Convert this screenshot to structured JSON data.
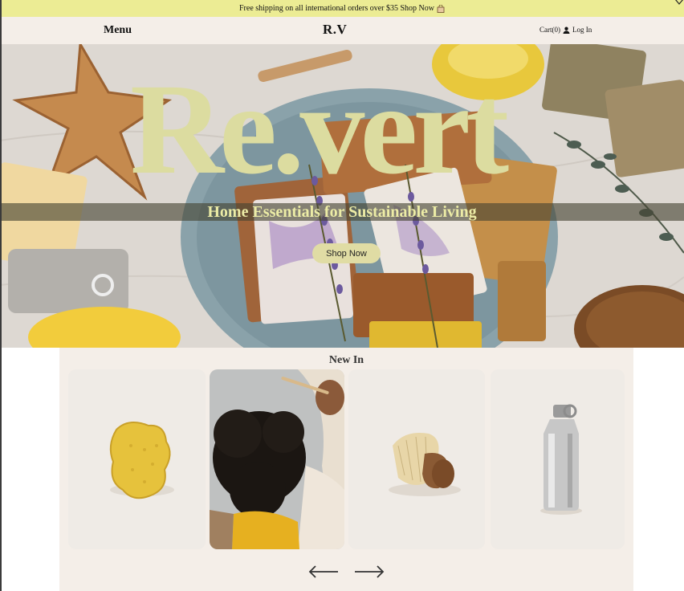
{
  "announcement": {
    "message": "Free shipping on all international orders over $35 Shop Now",
    "icon": "shopping-bag-icon"
  },
  "nav": {
    "menu_label": "Menu",
    "logo": "R.V",
    "cart_label": "Cart(0)",
    "login_label": "Log In",
    "background": "#f4eee8"
  },
  "hero": {
    "title": "Re.vert",
    "tagline": "Home Essentials for Sustainable Living",
    "cta_label": "Shop Now",
    "title_color": "#dcdca0"
  },
  "new_in": {
    "heading": "New In",
    "products": [
      {
        "image": "yellow loofah sponge"
      },
      {
        "image": "child with bamboo toothbrush"
      },
      {
        "image": "wooden bristle brush"
      },
      {
        "image": "stainless steel water bottle"
      }
    ],
    "prev_icon": "arrow-left-icon",
    "next_icon": "arrow-right-icon"
  },
  "colors": {
    "announcement_bg": "#ecec94",
    "section_bg": "#f4eee8",
    "accent": "#dcdca0"
  }
}
